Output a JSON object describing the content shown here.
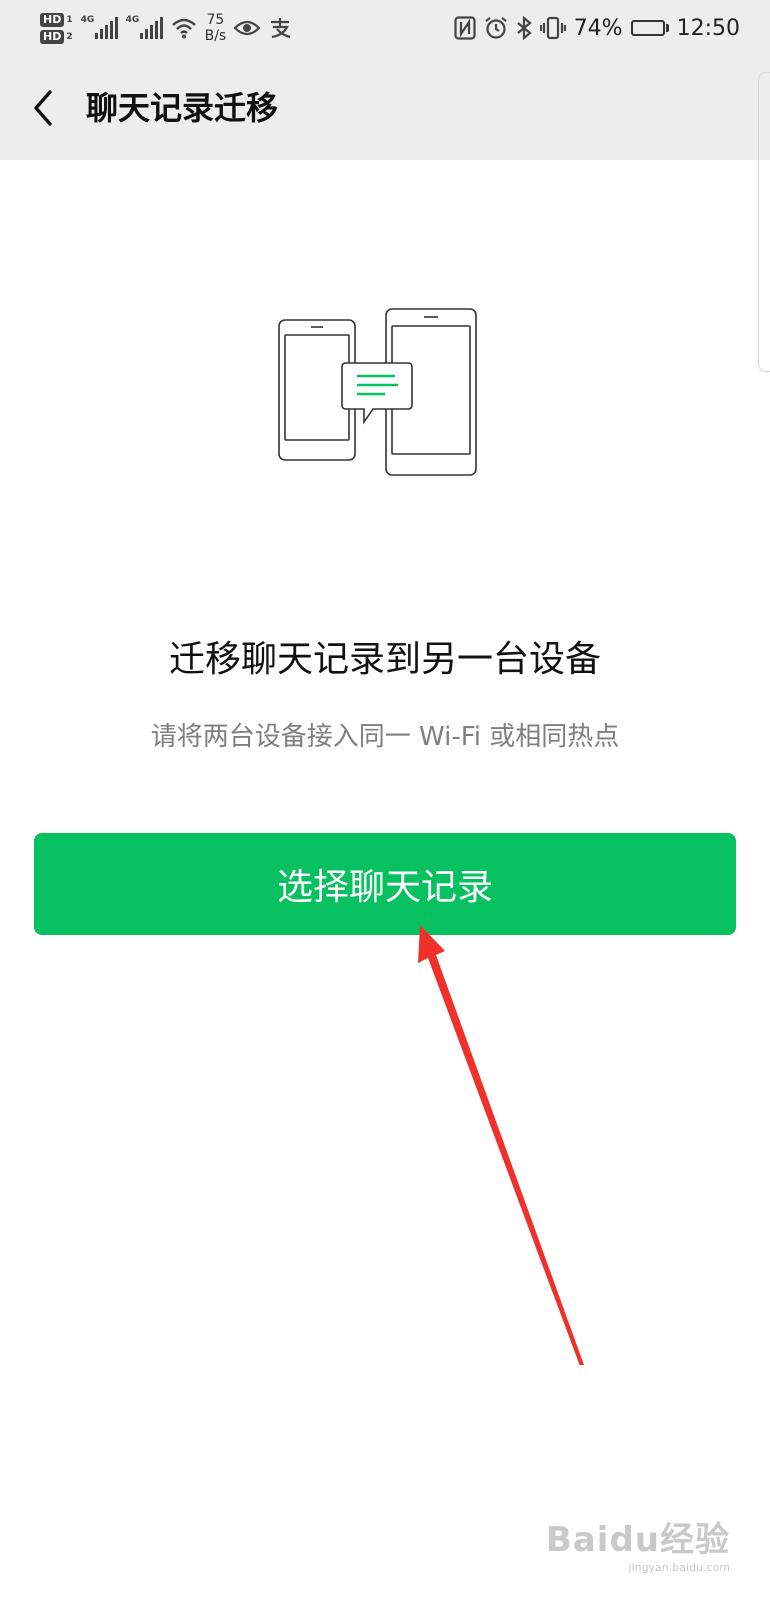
{
  "status_bar": {
    "sim1": "HD",
    "sim1_num": "1",
    "sim2": "HD",
    "sim2_num": "2",
    "net1": "4G",
    "net2": "4G",
    "speed_value": "75",
    "speed_unit": "B/s",
    "battery": "74%",
    "time": "12:50",
    "icons": [
      "wifi-icon",
      "eye-icon",
      "alipay-icon",
      "nfc-icon",
      "alarm-icon",
      "bluetooth-icon",
      "vibrate-icon",
      "battery-icon"
    ]
  },
  "header": {
    "title": "聊天记录迁移"
  },
  "main": {
    "headline": "迁移聊天记录到另一台设备",
    "subtext": "请将两台设备接入同一 Wi-Fi 或相同热点",
    "select_button_label": "选择聊天记录"
  },
  "watermark": {
    "main": "Baidu经验",
    "sub": "jingyan.baidu.com"
  },
  "colors": {
    "accent": "#07c160",
    "header_bg": "#ededed",
    "annotation_arrow": "#f0302a"
  }
}
